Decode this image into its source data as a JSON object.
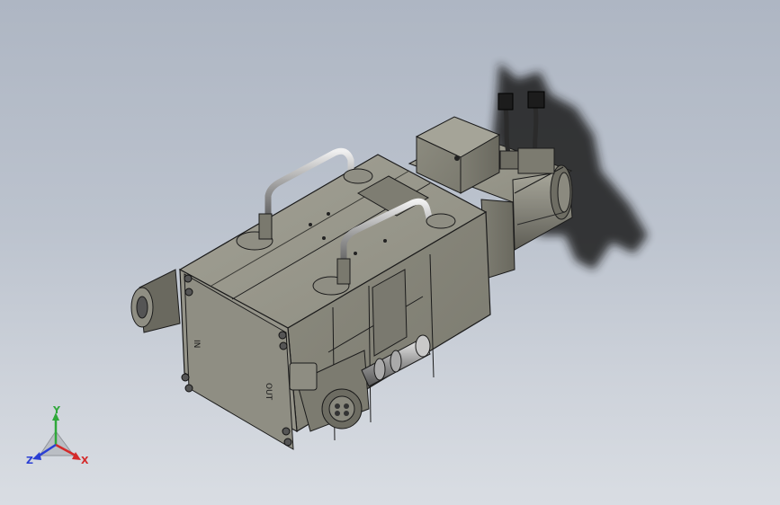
{
  "viewport": {
    "background_top": "#aeb6c3",
    "background_bottom": "#d9dde3"
  },
  "model": {
    "body_color": "#86857a",
    "body_light": "#9d9c90",
    "body_dark": "#6c6b61",
    "edge_color": "#1b1b1b",
    "panel_mark_in": "IN",
    "panel_mark_out": "OUT",
    "shadow_color": "#1a1a1a"
  },
  "triad": {
    "x_label": "X",
    "y_label": "Y",
    "z_label": "Z",
    "x_color": "#d42a2a",
    "y_color": "#2fa83a",
    "z_color": "#2a3fd4"
  }
}
